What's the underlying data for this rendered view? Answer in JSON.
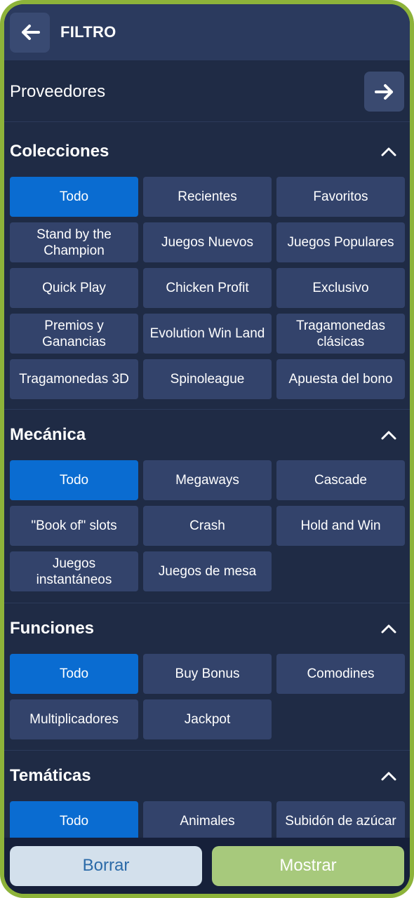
{
  "header": {
    "title": "FILTRO",
    "back_icon": "arrow-left-icon"
  },
  "providers": {
    "label": "Proveedores",
    "icon": "arrow-right-icon"
  },
  "sections": [
    {
      "title": "Colecciones",
      "chips": [
        "Todo",
        "Recientes",
        "Favoritos",
        "Stand by the Champion",
        "Juegos Nuevos",
        "Juegos Populares",
        "Quick Play",
        "Chicken Profit",
        "Exclusivo",
        "Premios y Ganancias",
        "Evolution Win Land",
        "Tragamonedas clásicas",
        "Tragamonedas 3D",
        "Spinoleague",
        "Apuesta del bono"
      ]
    },
    {
      "title": "Mecánica",
      "chips": [
        "Todo",
        "Megaways",
        "Cascade",
        "\"Book of\" slots",
        "Crash",
        "Hold and Win",
        "Juegos instantáneos",
        "Juegos de mesa"
      ]
    },
    {
      "title": "Funciones",
      "chips": [
        "Todo",
        "Buy Bonus",
        "Comodines",
        "Multiplicadores",
        "Jackpot"
      ]
    },
    {
      "title": "Temáticas",
      "chips": [
        "Todo",
        "Animales",
        "Subidón de azúcar"
      ]
    }
  ],
  "footer": {
    "clear_label": "Borrar",
    "show_label": "Mostrar"
  },
  "colors": {
    "active": "#0a6cd1",
    "chip": "#33436b",
    "background": "#1f2b45",
    "show_button": "#a7c97c"
  }
}
